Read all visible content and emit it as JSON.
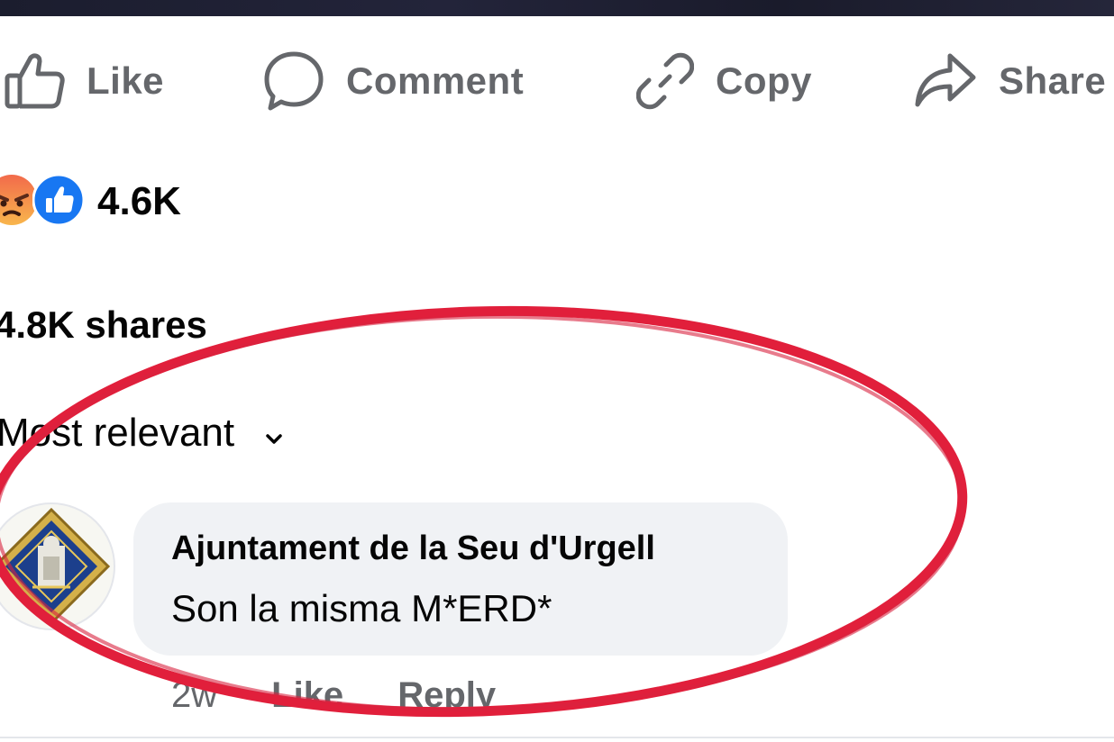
{
  "actions": {
    "like": "Like",
    "comment": "Comment",
    "copy": "Copy",
    "share": "Share"
  },
  "reactions": {
    "count": "4.6K",
    "icons": [
      "angry-reaction-icon",
      "like-reaction-icon"
    ]
  },
  "shares_text": "4.8K shares",
  "sort": {
    "label": "Most relevant",
    "icon": "chevron-down-icon"
  },
  "comment": {
    "author": "Ajuntament de la Seu d'Urgell",
    "text": "Son la misma M*ERD*",
    "time": "2w",
    "like_label": "Like",
    "reply_label": "Reply"
  },
  "colors": {
    "secondary_text": "#65676b",
    "bubble_bg": "#f0f2f5",
    "like_blue": "#1877f2",
    "angry_orange": "#f4714c",
    "annotation_red": "#e11f3b"
  }
}
